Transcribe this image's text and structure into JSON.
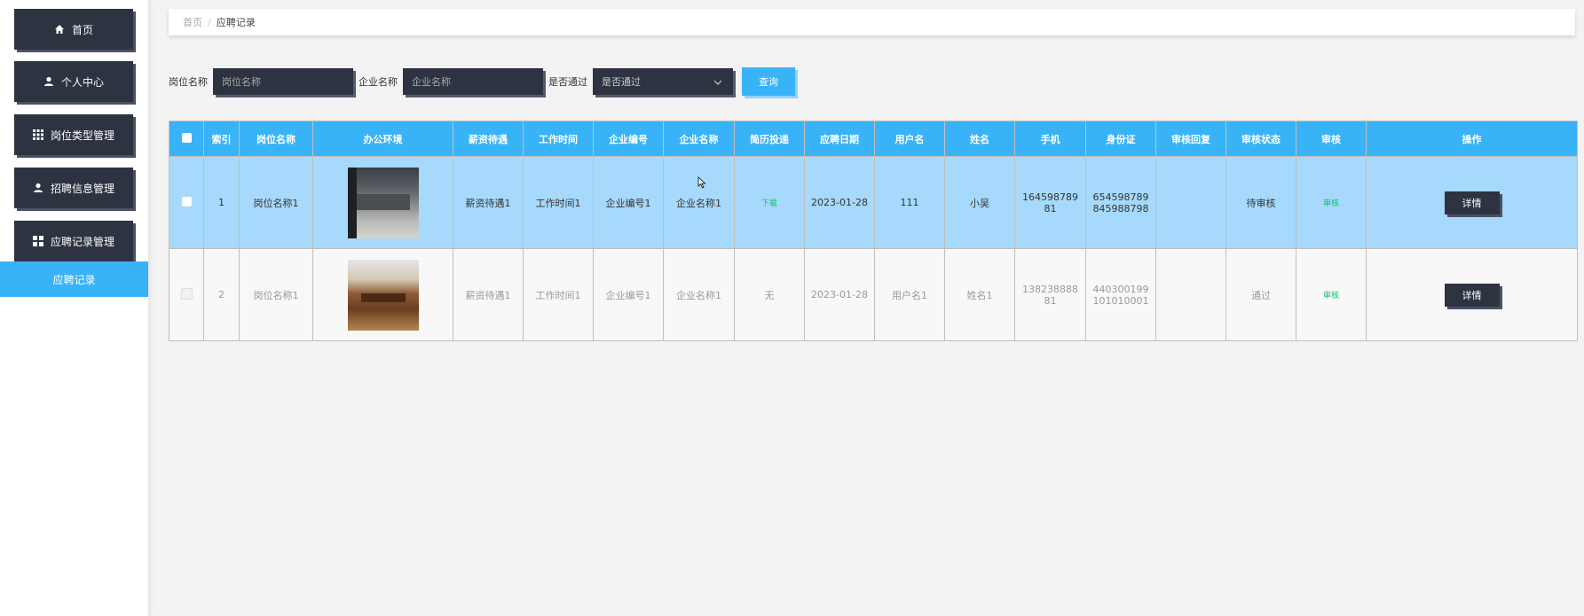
{
  "sidebar": {
    "items": [
      {
        "label": "首页",
        "icon": "home-icon"
      },
      {
        "label": "个人中心",
        "icon": "user-icon"
      },
      {
        "label": "岗位类型管理",
        "icon": "grid-icon"
      },
      {
        "label": "招聘信息管理",
        "icon": "user-icon"
      },
      {
        "label": "应聘记录管理",
        "icon": "apps-icon"
      }
    ],
    "active_sub": "应聘记录"
  },
  "breadcrumb": {
    "home": "首页",
    "current": "应聘记录"
  },
  "search": {
    "job_label": "岗位名称",
    "job_placeholder": "岗位名称",
    "company_label": "企业名称",
    "company_placeholder": "企业名称",
    "pass_label": "是否通过",
    "pass_value": "是否通过",
    "query_button": "查询"
  },
  "table": {
    "headers": [
      "索引",
      "岗位名称",
      "办公环境",
      "薪资待遇",
      "工作时间",
      "企业编号",
      "企业名称",
      "简历投递",
      "应聘日期",
      "用户名",
      "姓名",
      "手机",
      "身份证",
      "审核回复",
      "审核状态",
      "审核",
      "操作"
    ],
    "rows": [
      {
        "index": "1",
        "job": "岗位名称1",
        "salary": "薪资待遇1",
        "time": "工作时间1",
        "company_no": "企业编号1",
        "company": "企业名称1",
        "resume": "下载",
        "date": "2023-01-28",
        "username": "111",
        "name": "小吴",
        "phone_a": "164598789",
        "phone_b": "81",
        "id_a": "654598789",
        "id_b": "845988798",
        "reply": "",
        "status": "待审核",
        "review": "审核",
        "action": "详情"
      },
      {
        "index": "2",
        "job": "岗位名称1",
        "salary": "薪资待遇1",
        "time": "工作时间1",
        "company_no": "企业编号1",
        "company": "企业名称1",
        "resume": "无",
        "date": "2023-01-28",
        "username": "用户名1",
        "name": "姓名1",
        "phone_a": "138238888",
        "phone_b": "81",
        "id_a": "440300199",
        "id_b": "101010001",
        "reply": "",
        "status": "通过",
        "review": "审核",
        "action": "详情"
      }
    ]
  },
  "colors": {
    "accent": "#39b3f7",
    "dark": "#2d3341",
    "selected_row": "#a6d9fb",
    "review_green": "#19be6b"
  }
}
